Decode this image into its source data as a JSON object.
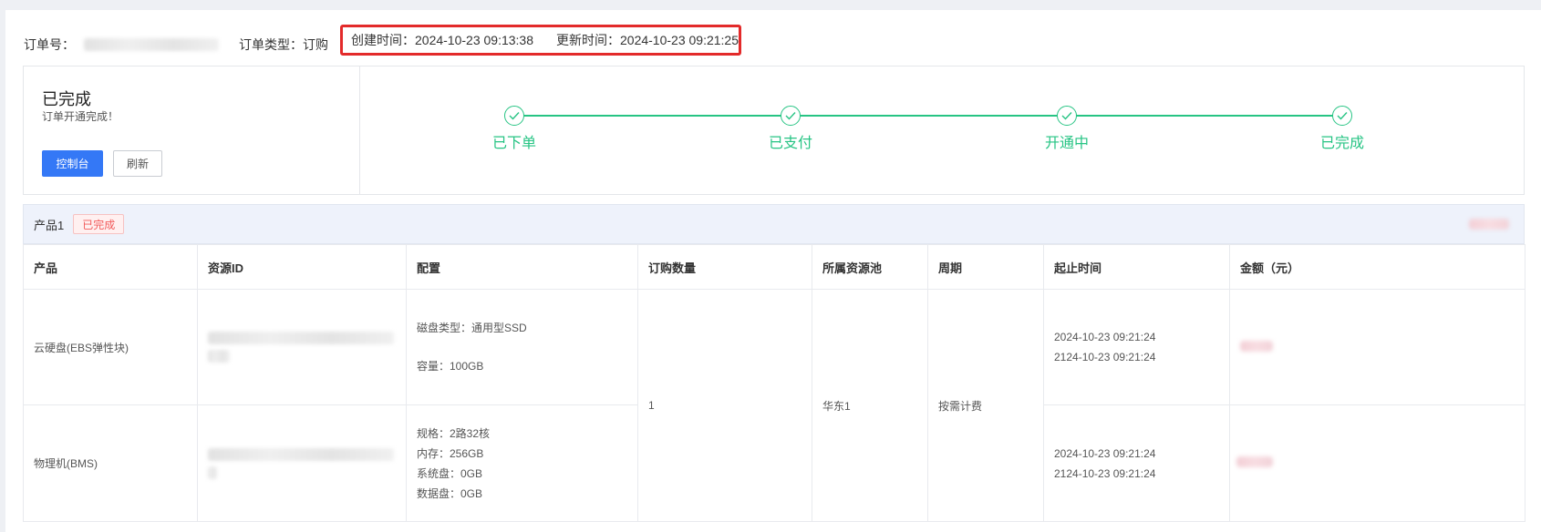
{
  "order": {
    "id_label": "订单号：",
    "type_label": "订单类型：",
    "type_value": "订购",
    "created_label": "创建时间：",
    "created_value": "2024-10-23 09:13:38",
    "updated_label": "更新时间：",
    "updated_value": "2024-10-23 09:21:25"
  },
  "status": {
    "title": "已完成",
    "subtitle": "订单开通完成！",
    "console_button": "控制台",
    "refresh_button": "刷新",
    "steps": [
      {
        "label": "已下单"
      },
      {
        "label": "已支付"
      },
      {
        "label": "开通中"
      },
      {
        "label": "已完成"
      }
    ],
    "accent_color": "#27c484"
  },
  "product": {
    "name": "产品1",
    "badge": "已完成"
  },
  "table": {
    "headers": [
      "产品",
      "资源ID",
      "配置",
      "订购数量",
      "所属资源池",
      "周期",
      "起止时间",
      "金额（元）"
    ],
    "quantity": "1",
    "pool": "华东1",
    "cycle": "按需计费",
    "rows": [
      {
        "product": "云硬盘(EBS弹性块)",
        "config": [
          "磁盘类型：通用型SSD",
          "容量：100GB"
        ],
        "start": "2024-10-23 09:21:24",
        "end": "2124-10-23 09:21:24"
      },
      {
        "product": "物理机(BMS)",
        "config": [
          "规格：2路32核",
          "内存：256GB",
          "系统盘：0GB",
          "数据盘：0GB"
        ],
        "start": "2024-10-23 09:21:24",
        "end": "2124-10-23 09:21:24"
      }
    ]
  }
}
